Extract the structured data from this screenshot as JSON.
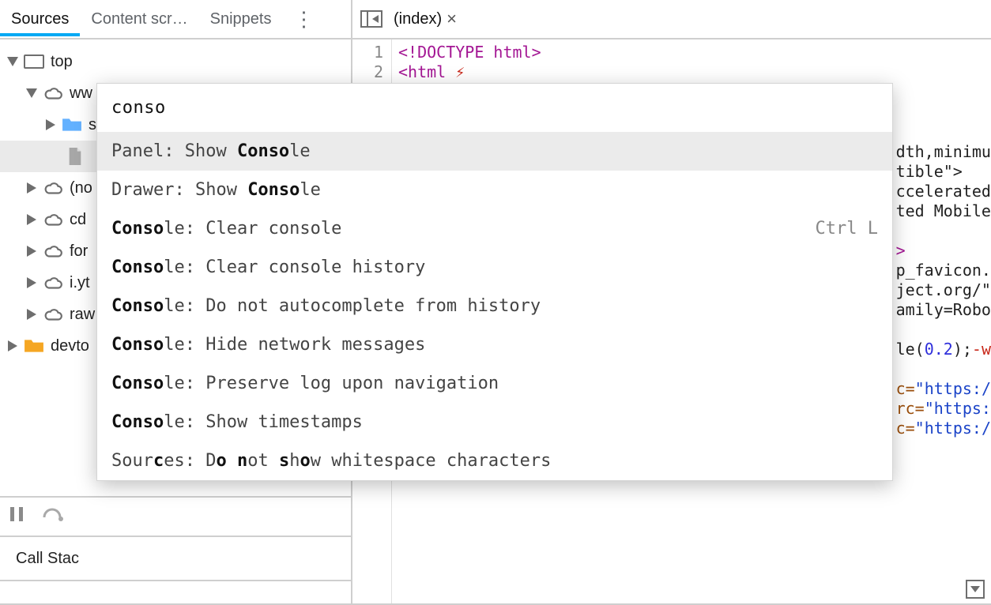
{
  "tabs": {
    "sources": "Sources",
    "content_scripts": "Content scr…",
    "snippets": "Snippets"
  },
  "tree": {
    "top": "top",
    "ww": "ww",
    "s_folder": "s",
    "file": "",
    "no": "(no",
    "cd": "cd",
    "for": "for",
    "iyt": "i.yt",
    "raw": "raw",
    "devto": "devto"
  },
  "call_stack_label": "Call Stac",
  "editor_tab": "(index)",
  "gutter": {
    "l1": "1",
    "l2": "2"
  },
  "code": {
    "line1": "<!DOCTYPE html>",
    "line2a": "<",
    "line2b": "html",
    "r1": "dth,minimu",
    "r2": "tible\">",
    "r3": "ccelerated",
    "r4": "ted Mobile",
    "r5": ">",
    "r6": "p_favicon.",
    "r7": "ject.org/\"",
    "r8": "amily=Robo",
    "r9a": "le(",
    "r9b": "0.2",
    "r9c": ");",
    "r9d": "-w",
    "r10a": "c=",
    "r10b": "\"https:/",
    "r11a": "rc=",
    "r11b": "\"https:",
    "r12a": "c=",
    "r12b": "\"https:/"
  },
  "command_menu": {
    "query": "conso",
    "items": [
      {
        "pre": "Panel: Show ",
        "bold": "Conso",
        "post": "le",
        "shortcut": ""
      },
      {
        "pre": "Drawer: Show ",
        "bold": "Conso",
        "post": "le",
        "shortcut": ""
      },
      {
        "pre": "",
        "bold": "Conso",
        "post": "le: Clear console",
        "shortcut": "Ctrl L"
      },
      {
        "pre": "",
        "bold": "Conso",
        "post": "le: Clear console history",
        "shortcut": ""
      },
      {
        "pre": "",
        "bold": "Conso",
        "post": "le: Do not autocomplete from history",
        "shortcut": ""
      },
      {
        "pre": "",
        "bold": "Conso",
        "post": "le: Hide network messages",
        "shortcut": ""
      },
      {
        "pre": "",
        "bold": "Conso",
        "post": "le: Preserve log upon navigation",
        "shortcut": ""
      },
      {
        "pre": "",
        "bold": "Conso",
        "post": "le: Show timestamps",
        "shortcut": ""
      }
    ],
    "scattered": {
      "p1": "Sour",
      "b1": "c",
      "p2": "es: D",
      "b2": "o",
      "p3": " ",
      "b3": "n",
      "p4": "ot ",
      "b4": "s",
      "p5": "h",
      "b5": "o",
      "p6": "w whitespace characters"
    }
  }
}
